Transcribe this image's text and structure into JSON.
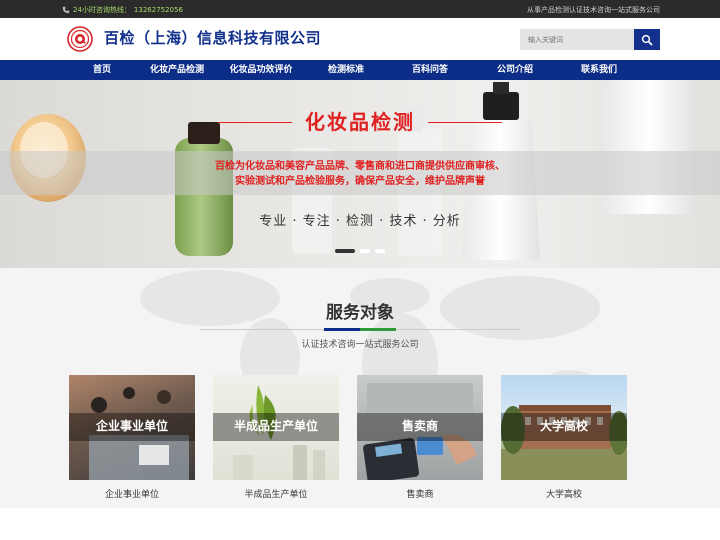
{
  "topbar": {
    "hotline_label": "24小时咨询热线：",
    "hotline_number": "13262752056",
    "slogan": "从事产品检测认证技术咨询一站式服务公司"
  },
  "header": {
    "company_name": "百检（上海）信息科技有限公司",
    "search_placeholder": "输入关键词"
  },
  "nav": {
    "items": [
      "首页",
      "化妆产品检测",
      "化妆品功效评价",
      "检测标准",
      "百科问答",
      "公司介绍",
      "联系我们"
    ]
  },
  "banner": {
    "title": "化妆品检测",
    "desc_line1": "百检为化妆品和美容产品品牌、零售商和进口商提供供应商审核、",
    "desc_line2": "实验测试和产品检验服务，确保产品安全，维护品牌声誉",
    "tagline": "专业 · 专注 · 检测 · 技术 · 分析",
    "slide_count": 3,
    "active_slide": 1
  },
  "services": {
    "title": "服务对象",
    "subtitle": "认证技术咨询一站式服务公司",
    "cards": [
      {
        "overlay": "企业事业单位",
        "caption": "企业事业单位"
      },
      {
        "overlay": "半成品生产单位",
        "caption": "半成品生产单位"
      },
      {
        "overlay": "售卖商",
        "caption": "售卖商"
      },
      {
        "overlay": "大学高校",
        "caption": "大学高校"
      }
    ]
  },
  "colors": {
    "nav_bg": "#0b2c87",
    "brand_blue": "#13318c",
    "banner_red": "#e02121",
    "hotline_green": "#a8d86a"
  }
}
